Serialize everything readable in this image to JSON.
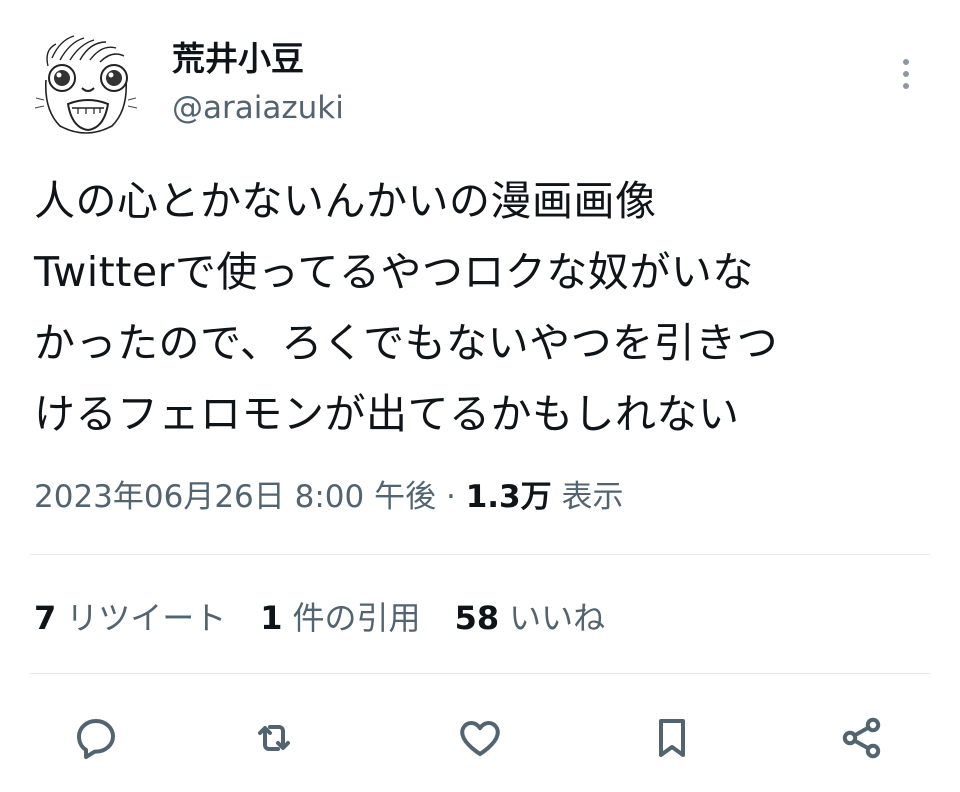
{
  "author": {
    "display_name": "荒井小豆",
    "handle": "@araiazuki",
    "avatar_icon": "manga-face-avatar"
  },
  "tweet": {
    "lines": [
      "人の心とかないんかいの漫画画像",
      "Twitterで使ってるやつロクな奴がいな",
      "かったので、ろくでもないやつを引きつ",
      "けるフェロモンが出てるかもしれない"
    ]
  },
  "meta": {
    "timestamp": "2023年06月26日 8:00 午後",
    "separator": "·",
    "views_count": "1.3万",
    "views_label": "表示"
  },
  "stats": {
    "retweets_count": "7",
    "retweets_label": "リツイート",
    "quotes_count": "1",
    "quotes_label": "件の引用",
    "likes_count": "58",
    "likes_label": "いいね"
  },
  "actions": [
    {
      "name": "reply",
      "icon": "reply-icon"
    },
    {
      "name": "retweet",
      "icon": "retweet-icon"
    },
    {
      "name": "like",
      "icon": "heart-icon"
    },
    {
      "name": "bookmark",
      "icon": "bookmark-icon"
    },
    {
      "name": "share",
      "icon": "share-icon"
    }
  ],
  "colors": {
    "text_primary": "#0f1419",
    "text_secondary": "#536471",
    "divider": "#e6e9ec"
  }
}
